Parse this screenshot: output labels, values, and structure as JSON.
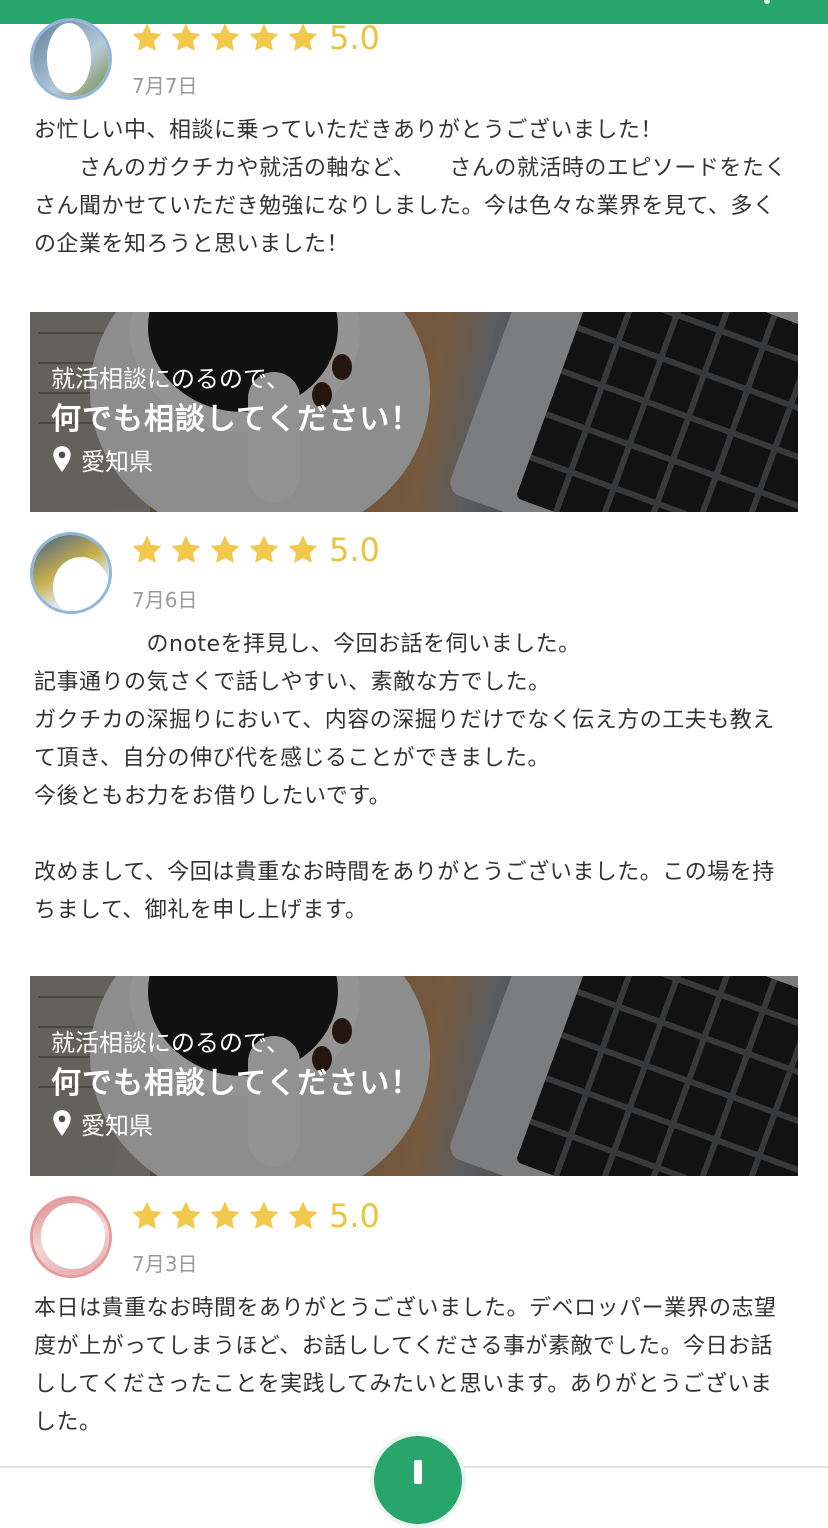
{
  "colors": {
    "accent_green": "#27a56a",
    "star_yellow": "#f2c94c",
    "date_gray": "#9a9a9a"
  },
  "reviews": [
    {
      "rating": 5,
      "score_label": "5.0",
      "date": "7月7日",
      "body": "お忙しい中、相談に乗っていただきありがとうございました！\n　　さんのガクチカや就活の軸など、　　さんの就活時のエピソードをたくさん聞かせていただき勉強になりしました。今は色々な業界を見て、多くの企業を知ろうと思いました！"
    },
    {
      "rating": 5,
      "score_label": "5.0",
      "date": "7月6日",
      "body": "　　　　　のnoteを拝見し、今回お話を伺いました。\n記事通りの気さくで話しやすい、素敵な方でした。\nガクチカの深掘りにおいて、内容の深掘りだけでなく伝え方の工夫も教えて頂き、自分の伸び代を感じることができました。\n今後ともお力をお借りしたいです。\n\n改めまして、今回は貴重なお時間をありがとうございました。この場を持ちまして、御礼を申し上げます。"
    },
    {
      "rating": 5,
      "score_label": "5.0",
      "date": "7月3日",
      "body": "本日は貴重なお時間をありがとうございました。デベロッパー業界の志望度が上がってしまうほど、お話ししてくださる事が素敵でした。今日お話ししてくださったことを実践してみたいと思います。ありがとうございました。"
    }
  ],
  "banner": {
    "subtitle": "就活相談にのるので、",
    "title": "何でも相談してください！",
    "location": "愛知県",
    "icon": "location-pin-icon"
  },
  "fab": {
    "icon": "plus-icon"
  }
}
